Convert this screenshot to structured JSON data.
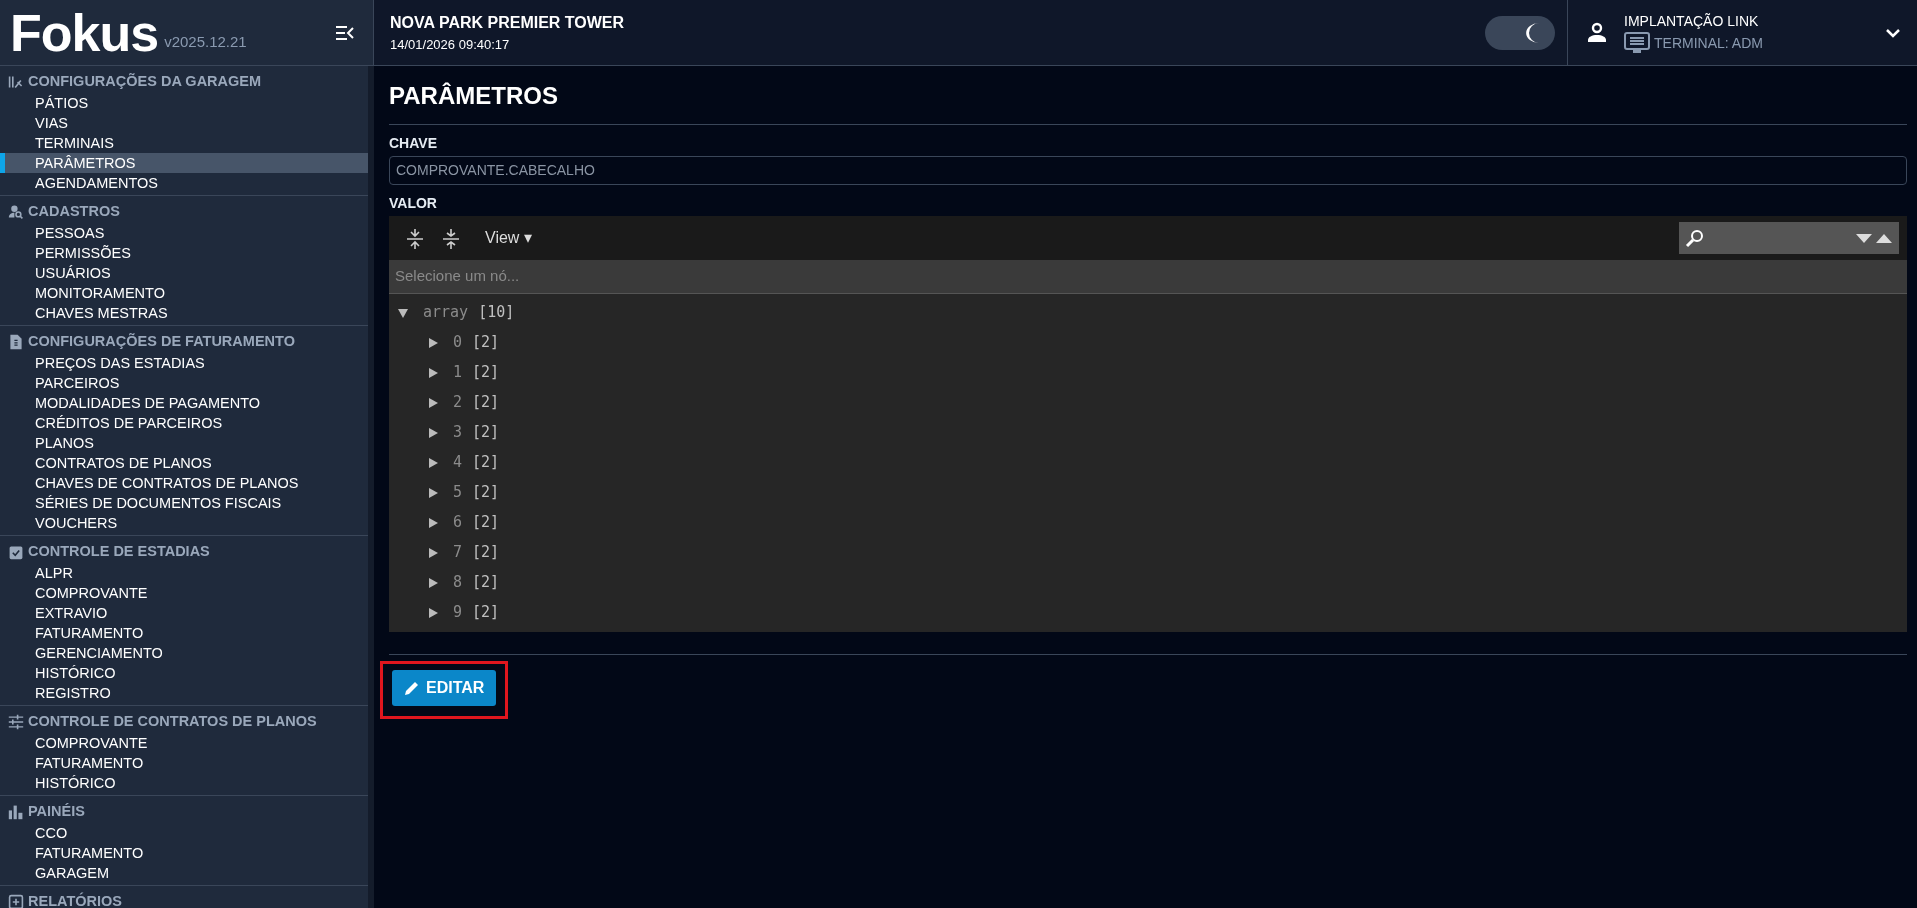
{
  "brand": {
    "logo": "Fokus",
    "version": "v2025.12.21"
  },
  "header": {
    "title": "NOVA PARK PREMIER TOWER",
    "datetime": "14/01/2026 09:40:17",
    "dark_mode": true,
    "user": "IMPLANTAÇÃO LINK",
    "terminal": "TERMINAL: ADM"
  },
  "sidebar": {
    "sections": [
      {
        "kind": "garage",
        "title": "CONFIGURAÇÕES DA GARAGEM",
        "items": [
          {
            "label": "PÁTIOS",
            "selected": false
          },
          {
            "label": "VIAS",
            "selected": false
          },
          {
            "label": "TERMINAIS",
            "selected": false
          },
          {
            "label": "PARÂMETROS",
            "selected": true
          },
          {
            "label": "AGENDAMENTOS",
            "selected": false
          }
        ]
      },
      {
        "kind": "people",
        "title": "CADASTROS",
        "items": [
          {
            "label": "PESSOAS",
            "selected": false
          },
          {
            "label": "PERMISSÕES",
            "selected": false
          },
          {
            "label": "USUÁRIOS",
            "selected": false
          },
          {
            "label": "MONITORAMENTO",
            "selected": false
          },
          {
            "label": "CHAVES MESTRAS",
            "selected": false
          }
        ]
      },
      {
        "kind": "invoice",
        "title": "CONFIGURAÇÕES DE FATURAMENTO",
        "items": [
          {
            "label": "PREÇOS DAS ESTADIAS",
            "selected": false
          },
          {
            "label": "PARCEIROS",
            "selected": false
          },
          {
            "label": "MODALIDADES DE PAGAMENTO",
            "selected": false
          },
          {
            "label": "CRÉDITOS DE PARCEIROS",
            "selected": false
          },
          {
            "label": "PLANOS",
            "selected": false
          },
          {
            "label": "CONTRATOS DE PLANOS",
            "selected": false
          },
          {
            "label": "CHAVES DE CONTRATOS DE PLANOS",
            "selected": false
          },
          {
            "label": "SÉRIES DE DOCUMENTOS FISCAIS",
            "selected": false
          },
          {
            "label": "VOUCHERS",
            "selected": false
          }
        ]
      },
      {
        "kind": "clipboard",
        "title": "CONTROLE DE ESTADIAS",
        "items": [
          {
            "label": "ALPR",
            "selected": false
          },
          {
            "label": "COMPROVANTE",
            "selected": false
          },
          {
            "label": "EXTRAVIO",
            "selected": false
          },
          {
            "label": "FATURAMENTO",
            "selected": false
          },
          {
            "label": "GERENCIAMENTO",
            "selected": false
          },
          {
            "label": "HISTÓRICO",
            "selected": false
          },
          {
            "label": "REGISTRO",
            "selected": false
          }
        ]
      },
      {
        "kind": "sliders",
        "title": "CONTROLE DE CONTRATOS DE PLANOS",
        "items": [
          {
            "label": "COMPROVANTE",
            "selected": false
          },
          {
            "label": "FATURAMENTO",
            "selected": false
          },
          {
            "label": "HISTÓRICO",
            "selected": false
          }
        ]
      },
      {
        "kind": "chart",
        "title": "PAINÉIS",
        "items": [
          {
            "label": "CCO",
            "selected": false
          },
          {
            "label": "FATURAMENTO",
            "selected": false
          },
          {
            "label": "GARAGEM",
            "selected": false
          }
        ]
      },
      {
        "kind": "report",
        "title": "RELATÓRIOS"
      }
    ]
  },
  "page": {
    "title": "PARÂMETROS",
    "key_label": "CHAVE",
    "key_value": "COMPROVANTE.CABECALHO",
    "value_label": "VALOR",
    "editor": {
      "view_menu": "View ▾",
      "path_placeholder": "Selecione um nó...",
      "tree": {
        "label": "array",
        "count": "[10]",
        "expanded": true,
        "children": [
          {
            "label": "0",
            "count": "[2]",
            "expanded": false
          },
          {
            "label": "1",
            "count": "[2]",
            "expanded": false
          },
          {
            "label": "2",
            "count": "[2]",
            "expanded": false
          },
          {
            "label": "3",
            "count": "[2]",
            "expanded": false
          },
          {
            "label": "4",
            "count": "[2]",
            "expanded": false
          },
          {
            "label": "5",
            "count": "[2]",
            "expanded": false
          },
          {
            "label": "6",
            "count": "[2]",
            "expanded": false
          },
          {
            "label": "7",
            "count": "[2]",
            "expanded": false
          },
          {
            "label": "8",
            "count": "[2]",
            "expanded": false
          },
          {
            "label": "9",
            "count": "[2]",
            "expanded": false
          }
        ]
      }
    },
    "edit_button": {
      "label": "EDITAR",
      "highlighted": true
    }
  }
}
